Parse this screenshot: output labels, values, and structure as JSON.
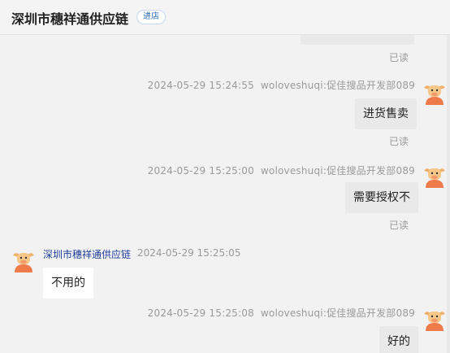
{
  "header": {
    "shop_name": "深圳市穗祥通供应链",
    "badge": "进店"
  },
  "icons": {
    "avatar": "cartoon-bull-avatar-icon"
  },
  "messages": [
    {
      "direction": "out",
      "text": "",
      "status": "已读"
    },
    {
      "direction": "out",
      "time": "2024-05-29 15:24:55",
      "sender": "woloveshuqi:促佳搜品开发部089",
      "text": "进货售卖",
      "status": "已读"
    },
    {
      "direction": "out",
      "time": "2024-05-29 15:25:00",
      "sender": "woloveshuqi:促佳搜品开发部089",
      "text": "需要授权不",
      "status": "已读"
    },
    {
      "direction": "in",
      "sender": "深圳市穗祥通供应链",
      "time": "2024-05-29 15:25:05",
      "text": "不用的"
    },
    {
      "direction": "out",
      "time": "2024-05-29 15:25:08",
      "sender": "woloveshuqi:促佳搜品开发部089",
      "text": "好的"
    }
  ]
}
